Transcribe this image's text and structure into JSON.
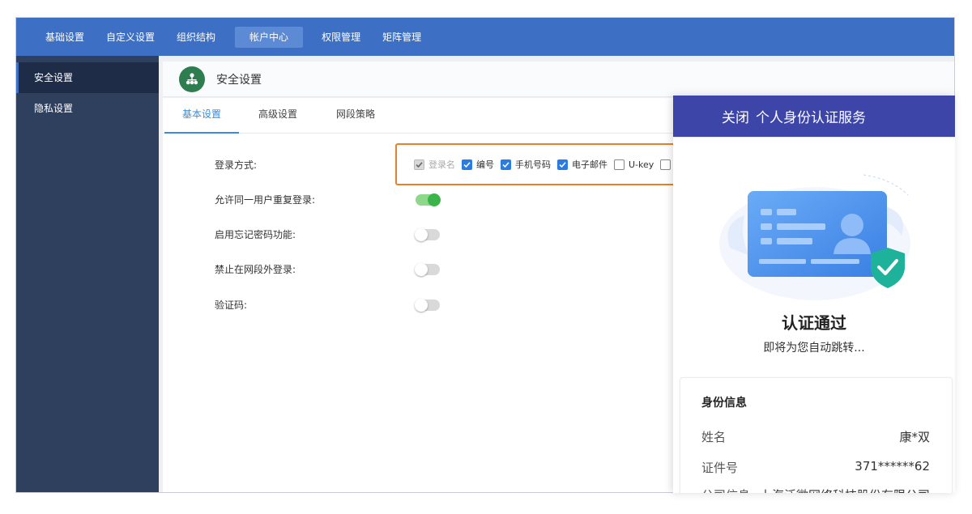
{
  "topnav": {
    "items": [
      "基础设置",
      "自定义设置",
      "组织结构",
      "帐户中心",
      "权限管理",
      "矩阵管理"
    ],
    "active_index": 3
  },
  "sidebar": {
    "items": [
      {
        "label": "安全设置",
        "active": true
      },
      {
        "label": "隐私设置",
        "active": false
      }
    ]
  },
  "panel": {
    "title": "安全设置",
    "icon": "org-chart-icon",
    "tabs": [
      {
        "label": "基本设置",
        "active": true
      },
      {
        "label": "高级设置",
        "active": false
      },
      {
        "label": "网段策略",
        "active": false
      }
    ]
  },
  "settings": {
    "login_method_label": "登录方式:",
    "login_options": [
      {
        "label": "登录名",
        "checked": true,
        "disabled": true
      },
      {
        "label": "编号",
        "checked": true,
        "disabled": false
      },
      {
        "label": "手机号码",
        "checked": true,
        "disabled": false
      },
      {
        "label": "电子邮件",
        "checked": true,
        "disabled": false
      },
      {
        "label": "U-key",
        "checked": false,
        "disabled": false
      }
    ],
    "toggles": [
      {
        "label": "允许同一用户重复登录:",
        "on": true
      },
      {
        "label": "启用忘记密码功能:",
        "on": false
      },
      {
        "label": "禁止在网段外登录:",
        "on": false
      },
      {
        "label": "验证码:",
        "on": false
      }
    ]
  },
  "overlay": {
    "close_label": "关闭",
    "title": "个人身份认证服务",
    "status": "认证通过",
    "sub": "即将为您自动跳转...",
    "info_title": "身份信息",
    "rows": [
      {
        "key": "姓名",
        "value": "康*双"
      },
      {
        "key": "证件号",
        "value": "371******62"
      },
      {
        "key": "公司信息",
        "value": "上海泛微网络科技股份有限公司"
      }
    ]
  },
  "colors": {
    "nav": "#3d6fc4",
    "sidebar": "#2f3f5e",
    "overlay_header": "#3d45a8",
    "highlight_border": "#e8812a",
    "checkbox": "#2b7be0",
    "toggle_on": "#3bb54a"
  }
}
